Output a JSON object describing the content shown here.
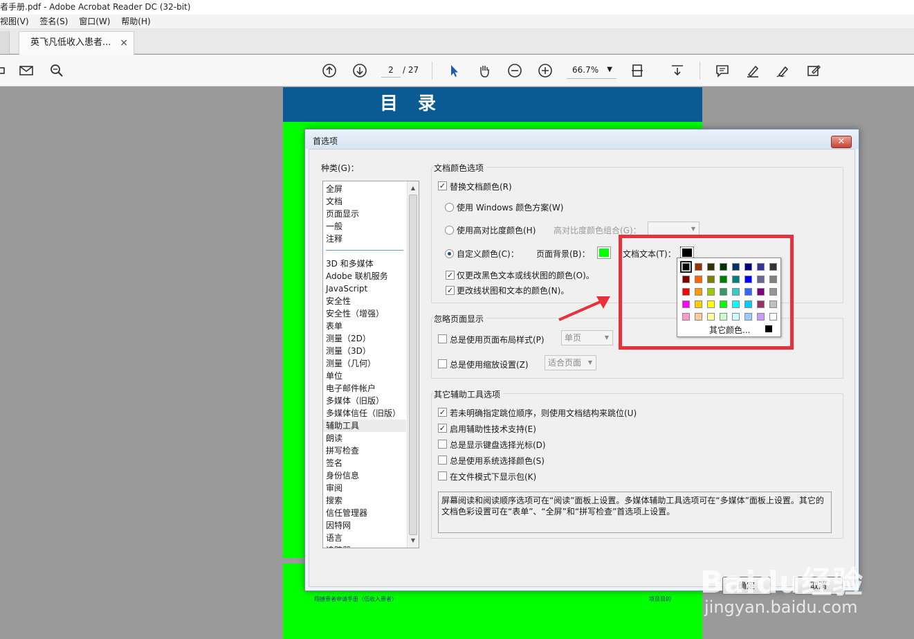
{
  "window": {
    "title": "者手册.pdf - Adobe Acrobat Reader DC (32-bit)"
  },
  "menu": [
    "视图(V)",
    "签名(S)",
    "窗口(W)",
    "帮助(H)"
  ],
  "tab": {
    "label": "英飞凡低收入患者...",
    "close": "×"
  },
  "toolbar": {
    "page_current": "2",
    "page_total": "/ 27",
    "zoom": "66.7%"
  },
  "document": {
    "header": "目 录",
    "footer_left": "翔捷患者申请手册（低收入患者）",
    "footer_right": "项目目的",
    "page_color": "#00ff00",
    "header_color": "#0a5a93"
  },
  "dialog": {
    "title": "首选项",
    "category_label": "种类(G)：",
    "categories": [
      "全屏",
      "文档",
      "页面显示",
      "一般",
      "注释",
      "3D 和多媒体",
      "Adobe 联机服务",
      "JavaScript",
      "安全性",
      "安全性（增强）",
      "表单",
      "测量（2D）",
      "测量（3D）",
      "测量（几何）",
      "单位",
      "电子邮件帐户",
      "多媒体（旧版）",
      "多媒体信任（旧版）",
      "辅助工具",
      "朗读",
      "拼写检查",
      "签名",
      "身份信息",
      "审阅",
      "搜索",
      "信任管理器",
      "因特网",
      "语言",
      "追踪器"
    ],
    "selected_category": "辅助工具",
    "doc_colors": {
      "title": "文档颜色选项",
      "replace": "替换文档颜色(R)",
      "use_windows": "使用 Windows 颜色方案(W)",
      "use_high_contrast": "使用高对比度颜色(H)",
      "high_contrast_combo_label": "高对比度颜色组合(G)：",
      "custom": "自定义颜色(C)：",
      "page_bg_label": "页面背景(B)：",
      "doc_text_label": "文档文本(T)：",
      "page_bg_color": "#00ff00",
      "doc_text_color": "#000000",
      "only_black": "仅更改黑色文本或线状图的颜色(O)。",
      "change_line_text": "更改线状图和文本的颜色(N)。"
    },
    "override": {
      "title": "忽略页面显示",
      "always_layout": "总是使用页面布局样式(P)",
      "layout_value": "单页",
      "always_zoom": "总是使用缩放设置(Z)",
      "zoom_value": "适合页面"
    },
    "other": {
      "title": "其它辅助工具选项",
      "opt1": "若未明确指定跳位顺序，则使用文档结构来跳位(U)",
      "opt2": "启用辅助性技术支持(E)",
      "opt3": "总是显示键盘选择光标(D)",
      "opt4": "总是使用系统选择颜色(S)",
      "opt5": "在文件模式下显示包(K)"
    },
    "info": "屏幕阅读和阅读顺序选项可在“阅读”面板上设置。多媒体辅助工具选项可在“多媒体”面板上设置。其它的文档色彩设置可在“表单”、“全屏”和“拼写检查”首选项上设置。",
    "ok": "确定",
    "cancel": "取消"
  },
  "color_picker": {
    "other_colors": "其它颜色...",
    "rows": [
      [
        "#000000",
        "#993300",
        "#333300",
        "#003300",
        "#003366",
        "#000080",
        "#333399",
        "#333333"
      ],
      [
        "#800000",
        "#ff6600",
        "#808000",
        "#008000",
        "#008080",
        "#0000ff",
        "#666699",
        "#808080"
      ],
      [
        "#ff0000",
        "#ff9900",
        "#99cc00",
        "#339966",
        "#33cccc",
        "#3366ff",
        "#800080",
        "#969696"
      ],
      [
        "#ff00ff",
        "#ffcc00",
        "#ffff00",
        "#00ff00",
        "#00ffff",
        "#00ccff",
        "#993366",
        "#c0c0c0"
      ],
      [
        "#ff99cc",
        "#ffcc99",
        "#ffff99",
        "#ccffcc",
        "#ccffff",
        "#99ccff",
        "#cc99ff",
        "#ffffff"
      ]
    ]
  },
  "watermark": {
    "brand": "Baidu经验",
    "url": "jingyan.baidu.com"
  },
  "colors": {
    "annotation_red": "#e6323c"
  }
}
